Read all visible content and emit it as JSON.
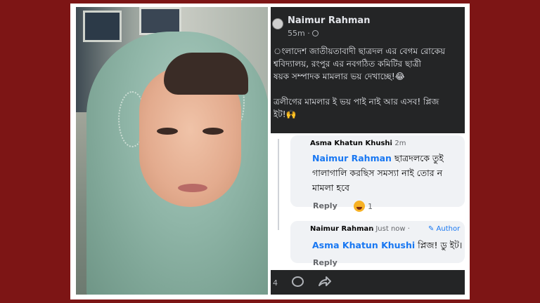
{
  "post": {
    "author": "Naimur Rahman",
    "time": "55m ·",
    "text": "ংলাদেশ জাতীয়তাবাদী ছাত্রদল এর বেগম রোকেয়\nশ্ববিদ্যালয়, রংপুর এর নবগঠিত কমিটির ছাত্রী\nষয়ক সম্পাদক মামলার ভয় দেখাচ্ছে!😂\n\nত্রলীগের মামলার ই ভয় পাই নাই আর এসব! প্লিজ\nইট!🙌",
    "reaction_count": "4"
  },
  "comments": [
    {
      "name": "Asma Khatun Khushi",
      "time": "· 2m",
      "mention": "Naimur Rahman",
      "line1": " ছাত্রদলকে তুই",
      "line2": "গালাগালি করছিস সমস্যা নাই তোর ন",
      "line3": "মামলা হবে",
      "reply": "Reply",
      "reactions": "1"
    },
    {
      "name": "Naimur Rahman",
      "time": "· Just now ·",
      "badge": "✎ Author",
      "mention": "Asma Khatun Khushi",
      "line1": " প্লিজ! ডু ইট।",
      "reply": "Reply"
    }
  ]
}
